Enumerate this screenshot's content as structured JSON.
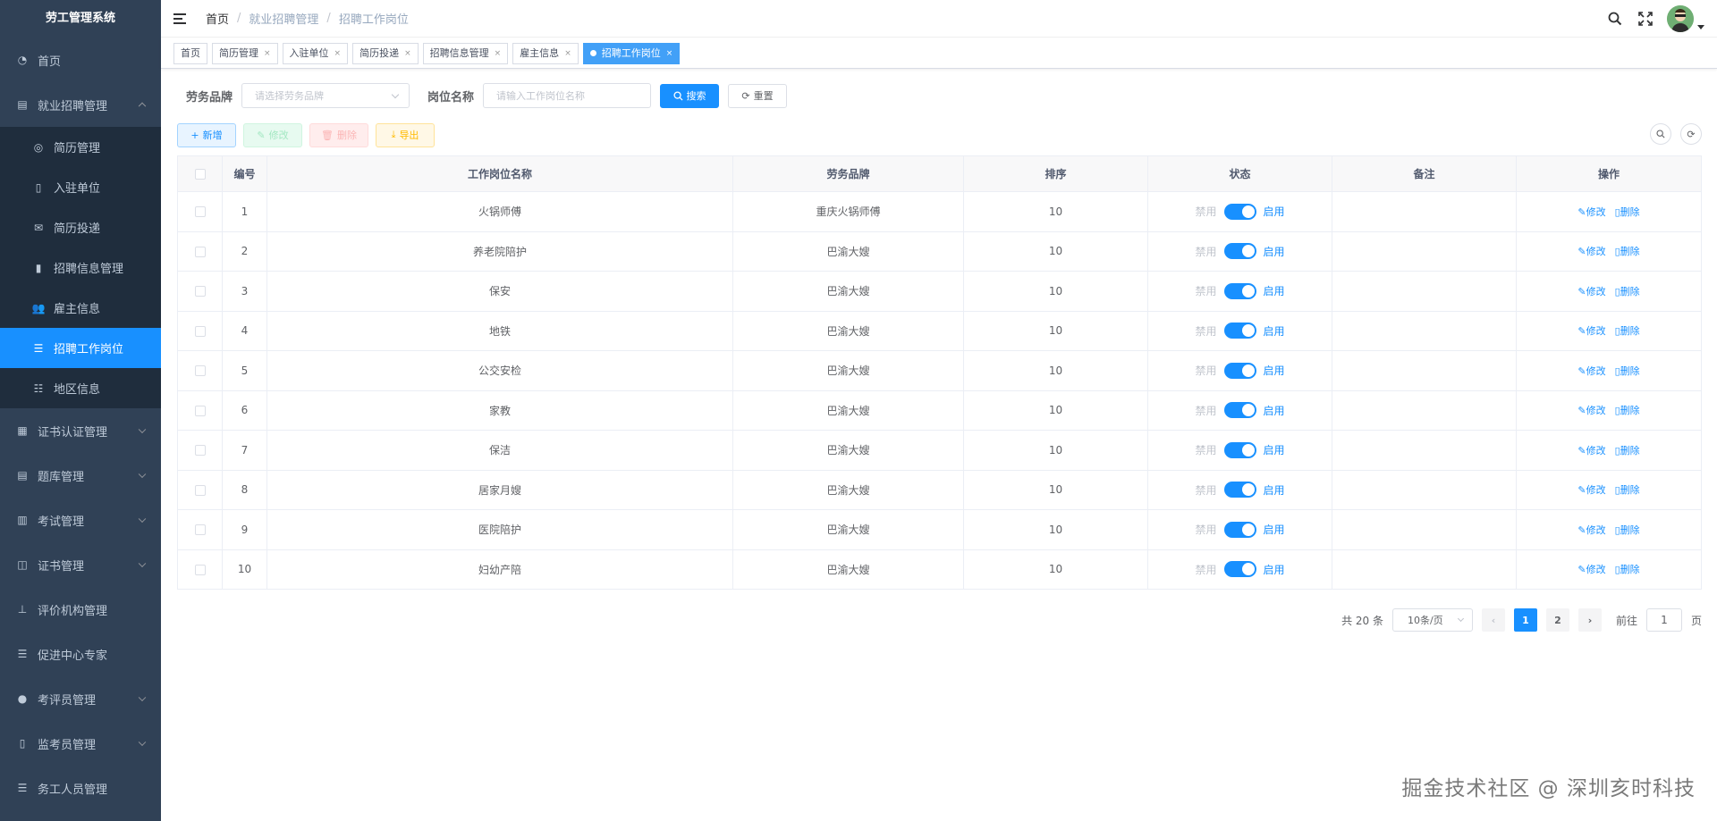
{
  "app": {
    "title": "劳工管理系统"
  },
  "sidebar": {
    "items": [
      {
        "label": "首页",
        "icon": "dashboard-icon",
        "expandable": false
      },
      {
        "label": "就业招聘管理",
        "icon": "document-icon",
        "expandable": true,
        "expanded": true,
        "children": [
          {
            "label": "简历管理",
            "icon": "user-card-icon",
            "active": false
          },
          {
            "label": "入驻单位",
            "icon": "building-icon",
            "active": false
          },
          {
            "label": "简历投递",
            "icon": "send-icon",
            "active": false
          },
          {
            "label": "招聘信息管理",
            "icon": "info-icon",
            "active": false
          },
          {
            "label": "雇主信息",
            "icon": "people-icon",
            "active": false
          },
          {
            "label": "招聘工作岗位",
            "icon": "list-icon",
            "active": true
          },
          {
            "label": "地区信息",
            "icon": "list-tree-icon",
            "active": false
          }
        ]
      },
      {
        "label": "证书认证管理",
        "icon": "certificate-icon",
        "expandable": true
      },
      {
        "label": "题库管理",
        "icon": "question-bank-icon",
        "expandable": true
      },
      {
        "label": "考试管理",
        "icon": "exam-icon",
        "expandable": true
      },
      {
        "label": "证书管理",
        "icon": "book-icon",
        "expandable": true
      },
      {
        "label": "评价机构管理",
        "icon": "org-tree-icon",
        "expandable": false
      },
      {
        "label": "促进中心专家",
        "icon": "list-icon",
        "expandable": false
      },
      {
        "label": "考评员管理",
        "icon": "user-icon",
        "expandable": true
      },
      {
        "label": "监考员管理",
        "icon": "inspector-icon",
        "expandable": true
      },
      {
        "label": "务工人员管理",
        "icon": "list-icon",
        "expandable": false
      }
    ]
  },
  "header": {
    "breadcrumb": [
      "首页",
      "就业招聘管理",
      "招聘工作岗位"
    ],
    "icons": [
      "search-icon",
      "fullscreen-icon",
      "avatar"
    ]
  },
  "tags": [
    {
      "label": "首页",
      "closable": false,
      "active": false
    },
    {
      "label": "简历管理",
      "closable": true,
      "active": false
    },
    {
      "label": "入驻单位",
      "closable": true,
      "active": false
    },
    {
      "label": "简历投递",
      "closable": true,
      "active": false
    },
    {
      "label": "招聘信息管理",
      "closable": true,
      "active": false
    },
    {
      "label": "雇主信息",
      "closable": true,
      "active": false
    },
    {
      "label": "招聘工作岗位",
      "closable": true,
      "active": true
    }
  ],
  "search": {
    "brand_label": "劳务品牌",
    "brand_placeholder": "请选择劳务品牌",
    "name_label": "岗位名称",
    "name_placeholder": "请输入工作岗位名称",
    "search_button": "搜索",
    "reset_button": "重置"
  },
  "toolbar": {
    "add": "新增",
    "edit": "修改",
    "delete": "删除",
    "export": "导出"
  },
  "table": {
    "columns": [
      "编号",
      "工作岗位名称",
      "劳务品牌",
      "排序",
      "状态",
      "备注",
      "操作"
    ],
    "switch_off_label": "禁用",
    "switch_on_label": "启用",
    "edit_label": "修改",
    "delete_label": "删除",
    "rows": [
      {
        "id": "1",
        "name": "火锅师傅",
        "brand": "重庆火锅师傅",
        "sort": "10",
        "enabled": true,
        "remark": ""
      },
      {
        "id": "2",
        "name": "养老院陪护",
        "brand": "巴渝大嫂",
        "sort": "10",
        "enabled": true,
        "remark": ""
      },
      {
        "id": "3",
        "name": "保安",
        "brand": "巴渝大嫂",
        "sort": "10",
        "enabled": true,
        "remark": ""
      },
      {
        "id": "4",
        "name": "地铁",
        "brand": "巴渝大嫂",
        "sort": "10",
        "enabled": true,
        "remark": ""
      },
      {
        "id": "5",
        "name": "公交安检",
        "brand": "巴渝大嫂",
        "sort": "10",
        "enabled": true,
        "remark": ""
      },
      {
        "id": "6",
        "name": "家教",
        "brand": "巴渝大嫂",
        "sort": "10",
        "enabled": true,
        "remark": ""
      },
      {
        "id": "7",
        "name": "保洁",
        "brand": "巴渝大嫂",
        "sort": "10",
        "enabled": true,
        "remark": ""
      },
      {
        "id": "8",
        "name": "居家月嫂",
        "brand": "巴渝大嫂",
        "sort": "10",
        "enabled": true,
        "remark": ""
      },
      {
        "id": "9",
        "name": "医院陪护",
        "brand": "巴渝大嫂",
        "sort": "10",
        "enabled": true,
        "remark": ""
      },
      {
        "id": "10",
        "name": "妇幼产陪",
        "brand": "巴渝大嫂",
        "sort": "10",
        "enabled": true,
        "remark": ""
      }
    ]
  },
  "pagination": {
    "total_text": "共 20 条",
    "page_size": "10条/页",
    "pages": [
      "1",
      "2"
    ],
    "current": "1",
    "goto_label": "前往",
    "goto_value": "1",
    "page_suffix": "页"
  },
  "watermark": "掘金技术社区 @ 深圳亥时科技",
  "colors": {
    "sidebar_bg": "#304156",
    "submenu_bg": "#1f2d3d",
    "accent": "#1890ff"
  }
}
